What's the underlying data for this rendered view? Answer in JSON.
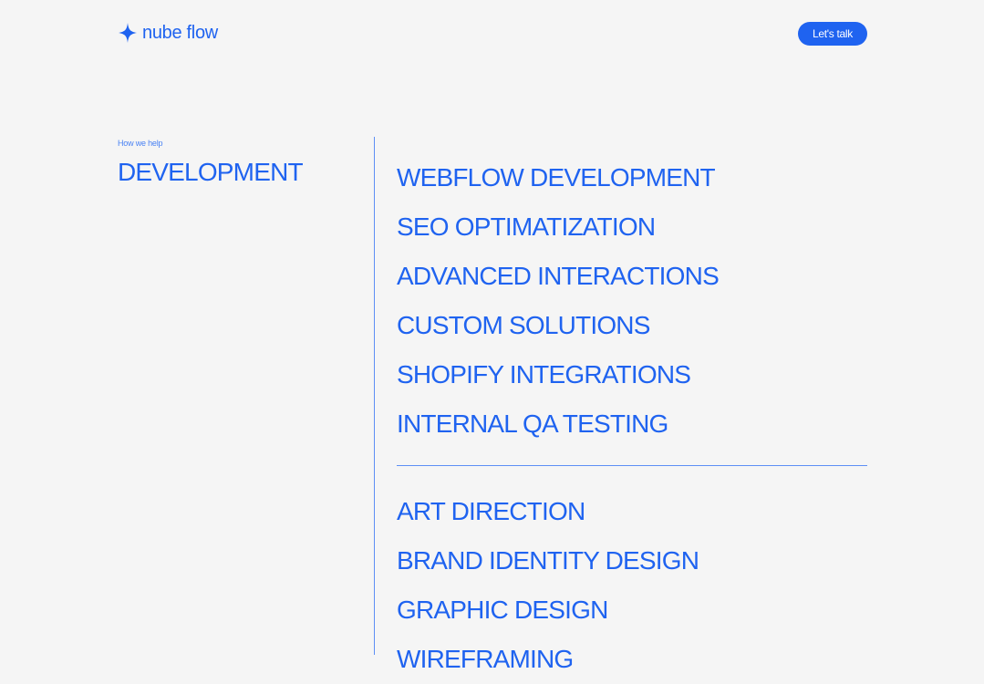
{
  "header": {
    "logo_text": "nube flow",
    "cta_label": "Let's talk"
  },
  "section": {
    "eyebrow": "How we help",
    "title": "DEVELOPMENT"
  },
  "services": {
    "development": [
      "WEBFLOW DEVELOPMENT",
      "SEO OPTIMATIZATION",
      "ADVANCED INTERACTIONS",
      "CUSTOM SOLUTIONS",
      "SHOPIFY INTEGRATIONS",
      "INTERNAL QA TESTING"
    ],
    "design": [
      "ART DIRECTION",
      "BRAND IDENTITY DESIGN",
      "GRAPHIC DESIGN",
      "WIREFRAMING"
    ]
  },
  "colors": {
    "brand": "#1f63f0",
    "background": "#f5f5f5",
    "line": "#5d8ff5"
  },
  "icons": {
    "logo": "sparkle-star-icon"
  }
}
